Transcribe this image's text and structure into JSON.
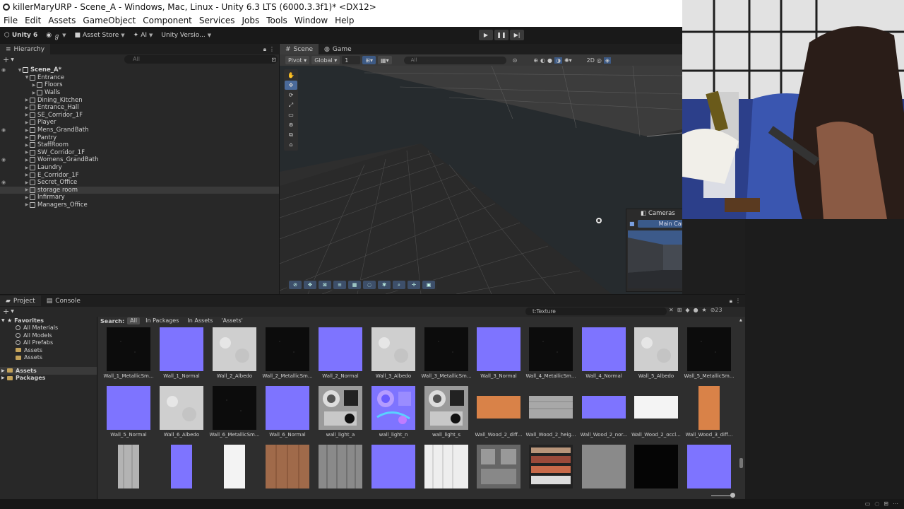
{
  "window": {
    "title": "killerMaryURP - Scene_A - Windows, Mac, Linux - Unity 6.3 LTS (6000.3.3f1)* <DX12>"
  },
  "menu": [
    "File",
    "Edit",
    "Assets",
    "GameObject",
    "Component",
    "Services",
    "Jobs",
    "Tools",
    "Window",
    "Help"
  ],
  "toolbar": {
    "unity_label": "Unity 6",
    "account_glyph": "ℊ",
    "asset_store": "Asset Store",
    "ai": "AI",
    "version_control": "Unity Versio..."
  },
  "hierarchy": {
    "tab": "Hierarchy",
    "search_placeholder": "All",
    "scene": "Scene_A*",
    "items": [
      {
        "label": "Entrance",
        "depth": 1,
        "expanded": true
      },
      {
        "label": "Floors",
        "depth": 2,
        "expanded": false
      },
      {
        "label": "Walls",
        "depth": 2,
        "expanded": false
      },
      {
        "label": "Dining_Kitchen",
        "depth": 1,
        "expanded": false
      },
      {
        "label": "Entrance_Hall",
        "depth": 1,
        "expanded": false
      },
      {
        "label": "SE_Corridor_1F",
        "depth": 1,
        "expanded": false
      },
      {
        "label": "Player",
        "depth": 1,
        "expanded": false
      },
      {
        "label": "Mens_GrandBath",
        "depth": 1,
        "expanded": false,
        "eye": true
      },
      {
        "label": "Pantry",
        "depth": 1,
        "expanded": false
      },
      {
        "label": "StaffRoom",
        "depth": 1,
        "expanded": false
      },
      {
        "label": "SW_Corridor_1F",
        "depth": 1,
        "expanded": false
      },
      {
        "label": "Womens_GrandBath",
        "depth": 1,
        "expanded": false,
        "eye": true
      },
      {
        "label": "Laundry",
        "depth": 1,
        "expanded": false
      },
      {
        "label": "E_Corridor_1F",
        "depth": 1,
        "expanded": false
      },
      {
        "label": "Secret_Office",
        "depth": 1,
        "expanded": false,
        "eye": true
      },
      {
        "label": "storage room",
        "depth": 1,
        "expanded": false,
        "selected": true
      },
      {
        "label": "Infirmary",
        "depth": 1,
        "expanded": false
      },
      {
        "label": "Managers_Office",
        "depth": 1,
        "expanded": false
      }
    ]
  },
  "scene_view": {
    "tabs": [
      "Scene",
      "Game"
    ],
    "pivot": "Pivot",
    "global": "Global",
    "snap_value": "1",
    "search_placeholder": "All"
  },
  "cameras_overlay": {
    "title": "Cameras",
    "selected_camera": "Main Camera"
  },
  "project": {
    "tabs": [
      "Project",
      "Console"
    ],
    "search_value": "t:Texture",
    "count": "23",
    "favorites_label": "Favorites",
    "favorites": [
      "All Materials",
      "All Models",
      "All Prefabs",
      "Assets",
      "Assets"
    ],
    "roots": [
      "Assets",
      "Packages"
    ],
    "search_label": "Search:",
    "filters": [
      "All",
      "In Packages",
      "In Assets",
      "'Assets'"
    ],
    "assets": [
      {
        "name": "Wall_1_MetallicSm...",
        "kind": "dark"
      },
      {
        "name": "Wall_1_Normal",
        "kind": "normal"
      },
      {
        "name": "Wall_2_Albedo",
        "kind": "light"
      },
      {
        "name": "Wall_2_MetallicSm...",
        "kind": "dark"
      },
      {
        "name": "Wall_2_Normal",
        "kind": "normal"
      },
      {
        "name": "Wall_3_Albedo",
        "kind": "light"
      },
      {
        "name": "Wall_3_MetallicSm...",
        "kind": "dark"
      },
      {
        "name": "Wall_3_Normal",
        "kind": "normal"
      },
      {
        "name": "Wall_4_MetallicSm...",
        "kind": "dark"
      },
      {
        "name": "Wall_4_Normal",
        "kind": "normal"
      },
      {
        "name": "Wall_5_Albedo",
        "kind": "light"
      },
      {
        "name": "Wall_5_MetallicSm...",
        "kind": "dark"
      },
      {
        "name": "Wall_5_Normal",
        "kind": "normal"
      },
      {
        "name": "Wall_6_Albedo",
        "kind": "light"
      },
      {
        "name": "Wall_6_MetallicSm...",
        "kind": "dark"
      },
      {
        "name": "Wall_6_Normal",
        "kind": "normal"
      },
      {
        "name": "wall_light_a",
        "kind": "pattern"
      },
      {
        "name": "wall_light_n",
        "kind": "normalpattern"
      },
      {
        "name": "wall_light_s",
        "kind": "pattern"
      },
      {
        "name": "Wall_Wood_2_diff...",
        "kind": "orange-strip"
      },
      {
        "name": "Wall_Wood_2_heig...",
        "kind": "gray-strip"
      },
      {
        "name": "Wall_Wood_2_nor...",
        "kind": "normal-strip"
      },
      {
        "name": "Wall_Wood_2_occl...",
        "kind": "white-strip"
      },
      {
        "name": "Wall_Wood_3_diff...",
        "kind": "orange-tall"
      },
      {
        "name": "",
        "kind": "gray-tall"
      },
      {
        "name": "",
        "kind": "normal-tall"
      },
      {
        "name": "",
        "kind": "white-tall"
      },
      {
        "name": "",
        "kind": "wood"
      },
      {
        "name": "",
        "kind": "wood-gray"
      },
      {
        "name": "",
        "kind": "normal"
      },
      {
        "name": "",
        "kind": "white-wood"
      },
      {
        "name": "",
        "kind": "panel"
      },
      {
        "name": "",
        "kind": "bricks"
      },
      {
        "name": "",
        "kind": "midgray"
      },
      {
        "name": "",
        "kind": "black"
      },
      {
        "name": "",
        "kind": "normal"
      }
    ]
  }
}
